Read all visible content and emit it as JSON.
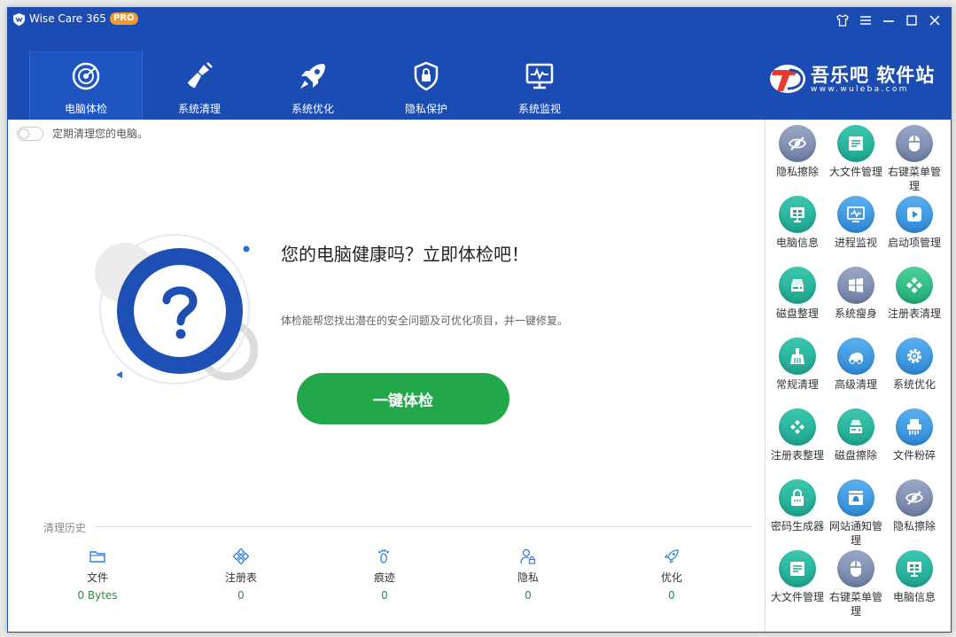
{
  "window": {
    "title": "Wise Care 365",
    "badge": "PRO"
  },
  "nav": {
    "tabs": [
      {
        "label": "电脑体检",
        "icon": "radar-icon"
      },
      {
        "label": "系统清理",
        "icon": "broom-icon"
      },
      {
        "label": "系统优化",
        "icon": "rocket-icon"
      },
      {
        "label": "隐私保护",
        "icon": "shield-lock-icon"
      },
      {
        "label": "系统监视",
        "icon": "monitor-pulse-icon"
      }
    ]
  },
  "brand": {
    "name": "吾乐吧 软件站",
    "url": "www.wuleba.com"
  },
  "main": {
    "schedule_label": "定期清理您的电脑。",
    "headline": "您的电脑健康吗？立即体检吧！",
    "subtext": "体检能帮您找出潜在的安全问题及可优化项目，并一键修复。",
    "scan_button": "一键体检",
    "history_label": "清理历史",
    "stats": [
      {
        "label": "文件",
        "value": "0 Bytes",
        "icon": "folder-icon"
      },
      {
        "label": "注册表",
        "value": "0",
        "icon": "registry-icon"
      },
      {
        "label": "痕迹",
        "value": "0",
        "icon": "footprint-icon"
      },
      {
        "label": "隐私",
        "value": "0",
        "icon": "user-lock-icon"
      },
      {
        "label": "优化",
        "value": "0",
        "icon": "rocket-icon"
      }
    ]
  },
  "sidebar": {
    "tools": [
      {
        "label": "隐私擦除",
        "icon": "eye-slash-icon",
        "color": "#7b89ad"
      },
      {
        "label": "大文件管理",
        "icon": "large-file-icon",
        "color": "#2db79e"
      },
      {
        "label": "右键菜单管理",
        "icon": "mouse-icon",
        "color": "#7b89ad"
      },
      {
        "label": "电脑信息",
        "icon": "computer-info-icon",
        "color": "#2db79e"
      },
      {
        "label": "进程监视",
        "icon": "process-monitor-icon",
        "color": "#3f98e0"
      },
      {
        "label": "启动项管理",
        "icon": "play-icon",
        "color": "#3f98e0"
      },
      {
        "label": "磁盘整理",
        "icon": "disk-defrag-icon",
        "color": "#2db79e"
      },
      {
        "label": "系统瘦身",
        "icon": "windows-icon",
        "color": "#7b89ad"
      },
      {
        "label": "注册表清理",
        "icon": "registry-clean-icon",
        "color": "#33c08a"
      },
      {
        "label": "常规清理",
        "icon": "broom-icon",
        "color": "#2db79e"
      },
      {
        "label": "高级清理",
        "icon": "vacuum-icon",
        "color": "#3f98e0"
      },
      {
        "label": "系统优化",
        "icon": "gear-icon",
        "color": "#3f98e0"
      },
      {
        "label": "注册表整理",
        "icon": "registry-defrag-icon",
        "color": "#2db79e"
      },
      {
        "label": "磁盘擦除",
        "icon": "disk-eraser-icon",
        "color": "#2db79e"
      },
      {
        "label": "文件粉碎",
        "icon": "shredder-icon",
        "color": "#3f98e0"
      },
      {
        "label": "密码生成器",
        "icon": "lock-icon",
        "color": "#2db79e"
      },
      {
        "label": "网站通知管理",
        "icon": "web-notification-icon",
        "color": "#3f98e0"
      },
      {
        "label": "隐私擦除",
        "icon": "eye-slash-icon",
        "color": "#7b89ad"
      },
      {
        "label": "大文件管理",
        "icon": "large-file-icon",
        "color": "#2db79e"
      },
      {
        "label": "右键菜单管理",
        "icon": "mouse-icon",
        "color": "#7b89ad"
      },
      {
        "label": "电脑信息",
        "icon": "computer-info-icon",
        "color": "#2db79e"
      }
    ]
  }
}
